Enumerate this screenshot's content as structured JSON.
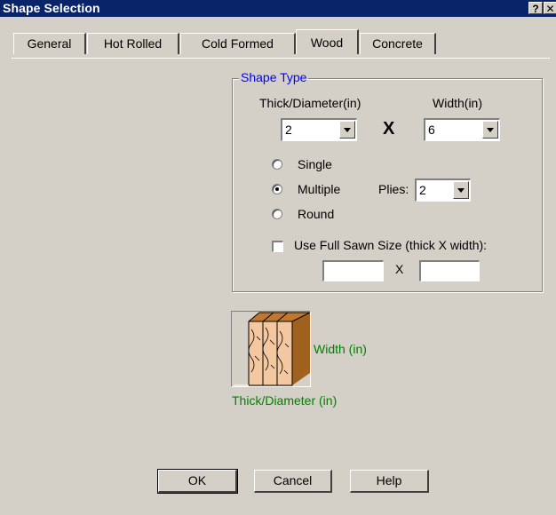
{
  "window": {
    "title": "Shape Selection",
    "help_glyph": "?",
    "close_glyph": "✕"
  },
  "tabs": [
    {
      "label": "General"
    },
    {
      "label": "Hot Rolled"
    },
    {
      "label": "Cold Formed"
    },
    {
      "label": "Wood",
      "active": true
    },
    {
      "label": "Concrete"
    }
  ],
  "shape_type": {
    "legend": "Shape Type",
    "thick_label": "Thick/Diameter(in)",
    "width_label": "Width(in)",
    "thick_value": "2",
    "times_label": "X",
    "width_value": "6",
    "radios": [
      {
        "label": "Single",
        "checked": false
      },
      {
        "label": "Multiple",
        "checked": true
      },
      {
        "label": "Round",
        "checked": false
      }
    ],
    "plies_label": "Plies:",
    "plies_value": "2",
    "full_sawn_label": "Use Full Sawn Size (thick X width):",
    "full_sawn_checked": false,
    "full_sawn_x": "X",
    "full_sawn_thick_value": "",
    "full_sawn_width_value": ""
  },
  "diagram": {
    "width_label": "Width (in)",
    "thick_label": "Thick/Diameter (in)"
  },
  "buttons": {
    "ok": "OK",
    "cancel": "Cancel",
    "help": "Help"
  },
  "colors": {
    "title_bar": "#0a246a",
    "legend": "#0000ff",
    "diagram_label": "#008000",
    "wood": "#a0601e"
  }
}
